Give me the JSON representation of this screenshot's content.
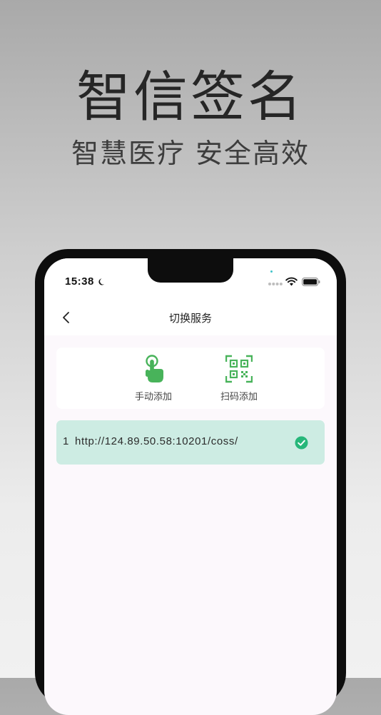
{
  "promo": {
    "title": "智信签名",
    "subtitle": "智慧医疗 安全高效"
  },
  "status_bar": {
    "time": "15:38",
    "icons": [
      "moon-icon",
      "signal-dots-icon",
      "wifi-icon",
      "battery-icon"
    ]
  },
  "nav": {
    "title": "切换服务",
    "back_icon": "chevron-left-icon"
  },
  "add_options": [
    {
      "label": "手动添加",
      "icon": "hand-tap-icon"
    },
    {
      "label": "扫码添加",
      "icon": "qr-scan-icon"
    }
  ],
  "servers": [
    {
      "index": "1",
      "url": "http://124.89.50.58:10201/coss/",
      "selected": true
    }
  ],
  "colors": {
    "accent_green": "#48b35a",
    "check_green": "#26b77a",
    "selected_row": "#cdece3",
    "screen_bg": "#fcf8fc"
  }
}
